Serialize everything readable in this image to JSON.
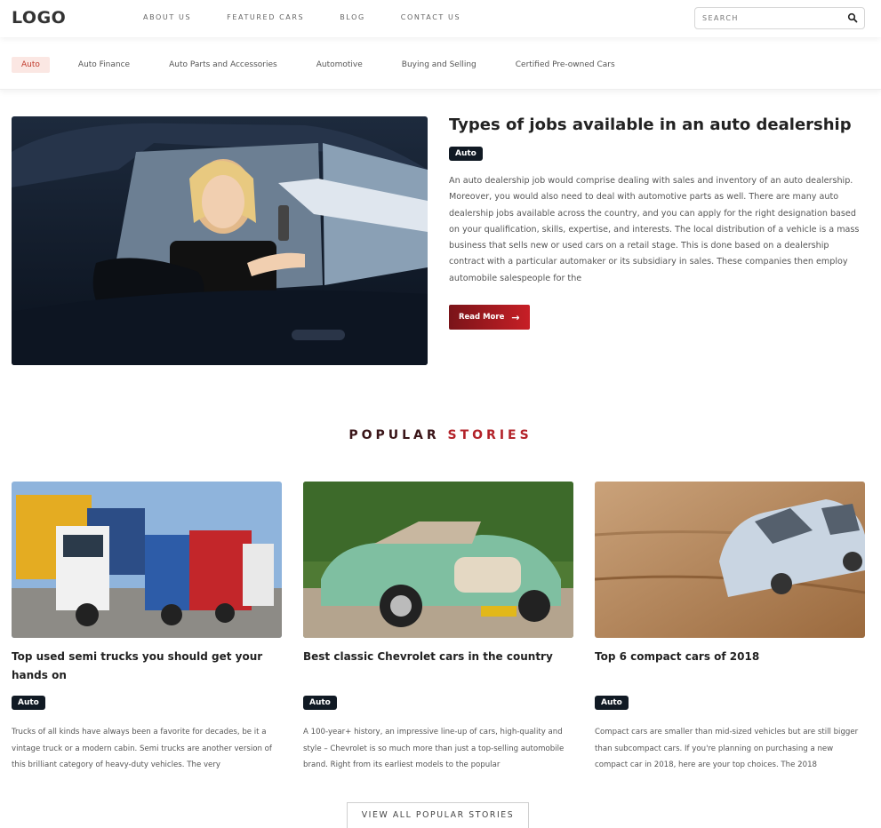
{
  "header": {
    "logo": "LOGO",
    "nav": [
      "ABOUT US",
      "FEATURED CARS",
      "BLOG",
      "CONTACT US"
    ],
    "search_placeholder": "SEARCH"
  },
  "categories": [
    {
      "label": "Auto",
      "active": true
    },
    {
      "label": "Auto Finance"
    },
    {
      "label": "Auto Parts and Accessories"
    },
    {
      "label": "Automotive"
    },
    {
      "label": "Buying and Selling"
    },
    {
      "label": "Certified Pre-owned Cars"
    }
  ],
  "featured": {
    "title": "Types of jobs available in an auto dealership",
    "badge": "Auto",
    "text": "An auto dealership job would comprise dealing with sales and inventory of an auto dealership. Moreover, you would also need to deal with automotive parts as well. There are many auto dealership jobs available across the country, and you can apply for the right designation based on your qualification, skills, expertise, and interests. The local distribution of a vehicle is a mass business that sells new or used cars on a retail stage. This is done based on a dealership contract with a particular automaker or its subsidiary in sales. These companies then employ automobile salespeople for the",
    "read_more": "Read More"
  },
  "popular": {
    "title_part1": "POPULAR",
    "title_part2": "STORIES",
    "cards": [
      {
        "title": "Top used semi trucks you should get your hands on",
        "badge": "Auto",
        "text": "Trucks of all kinds have always been a favorite for decades, be it a vintage truck or a modern cabin. Semi trucks are another version of this brilliant category of heavy-duty vehicles. The very"
      },
      {
        "title": "Best classic Chevrolet cars in the country",
        "badge": "Auto",
        "text": "A 100-year+ history, an impressive line-up of cars, high-quality and style – Chevrolet is so much more than just a top-selling automobile brand. Right from its earliest models to the popular"
      },
      {
        "title": "Top 6 compact cars of 2018",
        "badge": "Auto",
        "text": "Compact cars are smaller than mid-sized vehicles but are still bigger than subcompact cars. If you're planning on purchasing a new compact car in 2018, here are your top choices. The 2018"
      }
    ],
    "view_all": "VIEW ALL POPULAR STORIES"
  },
  "colors": {
    "accent": "#b3232a",
    "badge_bg": "#111a24",
    "active_category_bg": "#fbe7e3"
  }
}
